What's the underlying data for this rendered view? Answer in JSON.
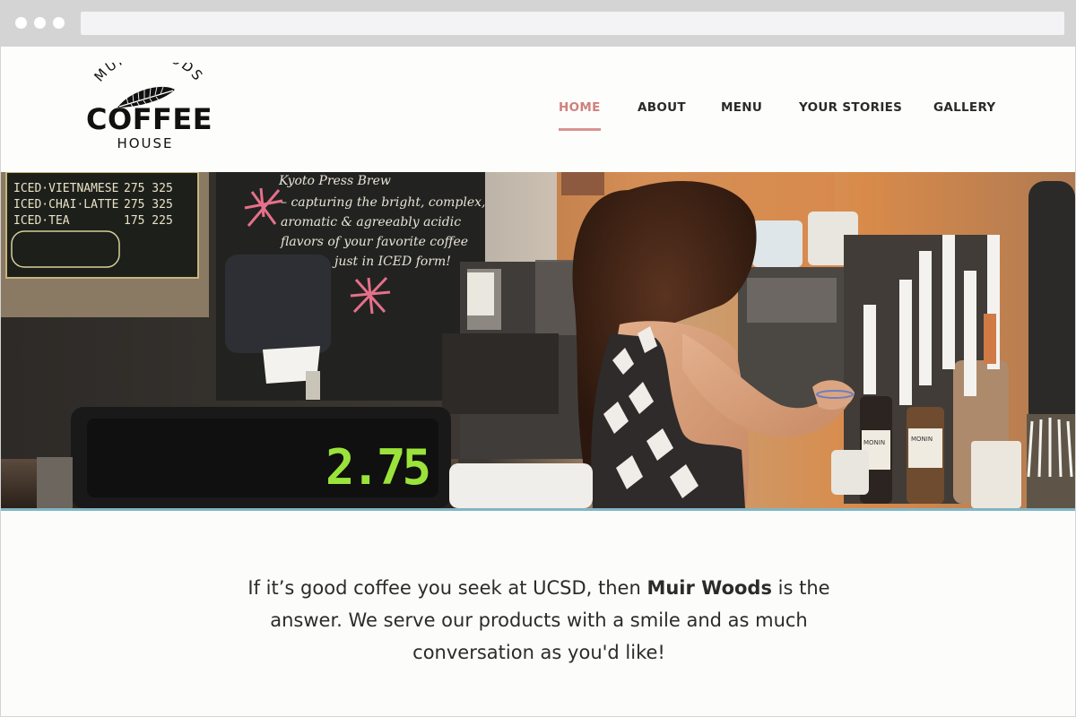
{
  "brand": {
    "logo_top": "MUIR WOODS",
    "logo_middle": "COFFEE",
    "logo_bottom": "HOUSE"
  },
  "nav": {
    "items": [
      {
        "label": "HOME",
        "active": true
      },
      {
        "label": "ABOUT",
        "active": false
      },
      {
        "label": "MENU",
        "active": false
      },
      {
        "label": "YOUR STORIES",
        "active": false
      },
      {
        "label": "GALLERY",
        "active": false
      }
    ]
  },
  "hero": {
    "register_display": "2.75",
    "menu_board_lines": [
      "ICED·VIETNAMESE",
      "ICED·CHAI·LATTE",
      "ICED·TEA"
    ],
    "menu_board_prices": [
      "275 325",
      "275 325",
      "175 225"
    ],
    "chalk_text": [
      "– capturing the bright, complex,",
      "aromatic & agreeably acidic",
      "flavors of your favorite coffee",
      "just in ICED form!"
    ],
    "chalk_title": "Kyoto Press Brew",
    "syrup_label": "MONIN",
    "accent_line_color": "#7fb6c4"
  },
  "intro": {
    "part1": "If it’s good coffee you seek at UCSD, then ",
    "bold": "Muir Woods",
    "part2": " is the answer. We serve our products with a smile and as much conversation as you'd like!"
  },
  "colors": {
    "accent": "#d07f7d",
    "text": "#2b2b2b",
    "background": "#fcfcfa"
  }
}
